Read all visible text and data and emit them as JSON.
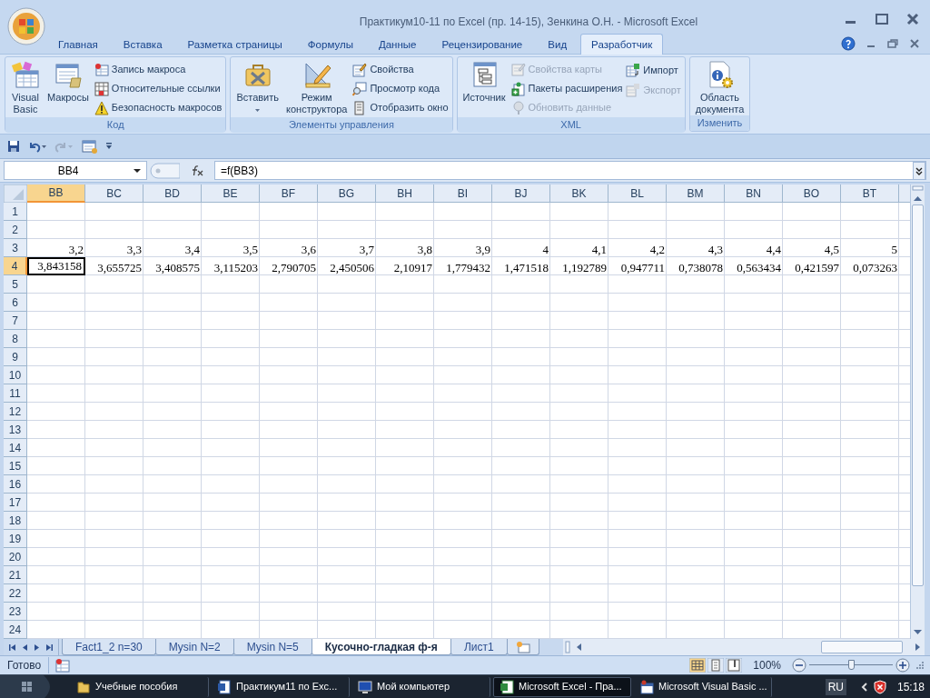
{
  "window": {
    "title": "Практикум10-11 по Excel (пр. 14-15), Зенкина О.Н. - Microsoft Excel"
  },
  "ribbon": {
    "tabs": [
      {
        "label": "Главная",
        "selected": false
      },
      {
        "label": "Вставка",
        "selected": false
      },
      {
        "label": "Разметка страницы",
        "selected": false
      },
      {
        "label": "Формулы",
        "selected": false
      },
      {
        "label": "Данные",
        "selected": false
      },
      {
        "label": "Рецензирование",
        "selected": false
      },
      {
        "label": "Вид",
        "selected": false
      },
      {
        "label": "Разработчик",
        "selected": true
      }
    ],
    "groups": [
      {
        "label": "Код",
        "columns": [
          [
            {
              "label": "Visual Basic",
              "kind": "large",
              "disabled": false
            }
          ],
          [
            {
              "label": "Макросы",
              "kind": "large",
              "disabled": false
            }
          ],
          [
            {
              "label": "Запись макроса",
              "kind": "small",
              "disabled": false
            },
            {
              "label": "Относительные ссылки",
              "kind": "small",
              "disabled": false
            },
            {
              "label": "Безопасность макросов",
              "kind": "small",
              "disabled": false
            }
          ]
        ]
      },
      {
        "label": "Элементы управления",
        "columns": [
          [
            {
              "label": "Вставить",
              "kind": "dropdown",
              "disabled": false
            }
          ],
          [
            {
              "label": "Режим конструктора",
              "kind": "large",
              "disabled": false
            }
          ],
          [
            {
              "label": "Свойства",
              "kind": "small",
              "disabled": false
            },
            {
              "label": "Просмотр кода",
              "kind": "small",
              "disabled": false
            },
            {
              "label": "Отобразить окно",
              "kind": "small",
              "disabled": false
            }
          ]
        ]
      },
      {
        "label": "XML",
        "columns": [
          [
            {
              "label": "Источник",
              "kind": "large",
              "disabled": false
            }
          ],
          [
            {
              "label": "Свойства карты",
              "kind": "small",
              "disabled": true
            },
            {
              "label": "Пакеты расширения",
              "kind": "small",
              "disabled": false
            },
            {
              "label": "Обновить данные",
              "kind": "small",
              "disabled": true
            }
          ],
          [
            {
              "label": "Импорт",
              "kind": "small",
              "disabled": false
            },
            {
              "label": "Экспорт",
              "kind": "small",
              "disabled": true
            }
          ]
        ]
      },
      {
        "label": "Изменить",
        "columns": [
          [
            {
              "label": "Область документа",
              "kind": "large",
              "disabled": false
            }
          ]
        ]
      }
    ]
  },
  "formula_bar": {
    "name_box": "BB4",
    "formula": "=f(BB3)"
  },
  "sheet": {
    "columns": [
      {
        "label": "BB",
        "selected": true
      },
      {
        "label": "BC",
        "selected": false
      },
      {
        "label": "BD",
        "selected": false
      },
      {
        "label": "BE",
        "selected": false
      },
      {
        "label": "BF",
        "selected": false
      },
      {
        "label": "BG",
        "selected": false
      },
      {
        "label": "BH",
        "selected": false
      },
      {
        "label": "BI",
        "selected": false
      },
      {
        "label": "BJ",
        "selected": false
      },
      {
        "label": "BK",
        "selected": false
      },
      {
        "label": "BL",
        "selected": false
      },
      {
        "label": "BM",
        "selected": false
      },
      {
        "label": "BN",
        "selected": false
      },
      {
        "label": "BO",
        "selected": false
      },
      {
        "label": "BT",
        "selected": false
      }
    ],
    "rows": [
      {
        "label": "1",
        "selected": false
      },
      {
        "label": "2",
        "selected": false
      },
      {
        "label": "3",
        "selected": false,
        "cells": [
          "3,2",
          "3,3",
          "3,4",
          "3,5",
          "3,6",
          "3,7",
          "3,8",
          "3,9",
          "4",
          "4,1",
          "4,2",
          "4,3",
          "4,4",
          "4,5",
          "5"
        ]
      },
      {
        "label": "4",
        "selected": true,
        "cells": [
          "3,843158",
          "3,655725",
          "3,408575",
          "3,115203",
          "2,790705",
          "2,450506",
          "2,10917",
          "1,779432",
          "1,471518",
          "1,192789",
          "0,947711",
          "0,738078",
          "0,563434",
          "0,421597",
          "0,073263"
        ]
      },
      {
        "label": "5",
        "selected": false
      },
      {
        "label": "6",
        "selected": false
      },
      {
        "label": "7",
        "selected": false
      },
      {
        "label": "8",
        "selected": false
      },
      {
        "label": "9",
        "selected": false
      },
      {
        "label": "10",
        "selected": false
      },
      {
        "label": "11",
        "selected": false
      },
      {
        "label": "12",
        "selected": false
      },
      {
        "label": "13",
        "selected": false
      },
      {
        "label": "14",
        "selected": false
      },
      {
        "label": "15",
        "selected": false
      },
      {
        "label": "16",
        "selected": false
      },
      {
        "label": "17",
        "selected": false
      },
      {
        "label": "18",
        "selected": false
      },
      {
        "label": "19",
        "selected": false
      },
      {
        "label": "20",
        "selected": false
      },
      {
        "label": "21",
        "selected": false
      },
      {
        "label": "22",
        "selected": false
      },
      {
        "label": "23",
        "selected": false
      },
      {
        "label": "24",
        "selected": false
      }
    ]
  },
  "sheet_tabs": [
    {
      "label": "Fact1_2 n=30",
      "selected": false
    },
    {
      "label": "Mysin N=2",
      "selected": false
    },
    {
      "label": "Mysin N=5",
      "selected": false
    },
    {
      "label": "Кусочно-гладкая ф-я",
      "selected": true
    },
    {
      "label": "Лист1",
      "selected": false
    }
  ],
  "status_bar": {
    "text": "Готово",
    "view_buttons": [
      {
        "selected": true
      },
      {
        "selected": false
      },
      {
        "selected": false
      }
    ],
    "zoom": "100%",
    "zoom_slider": {
      "level": 0.5
    }
  },
  "taskbar": {
    "items": [
      {
        "label": "Учебные пособия",
        "active": false
      },
      {
        "label": "Практикум11 по Exc...",
        "active": false
      },
      {
        "label": "Мой компьютер",
        "active": false
      },
      {
        "label": "Microsoft Excel - Пра...",
        "active": true
      },
      {
        "label": "Microsoft Visual Basic ...",
        "active": false
      }
    ],
    "language": "RU",
    "clock": "15:18"
  }
}
